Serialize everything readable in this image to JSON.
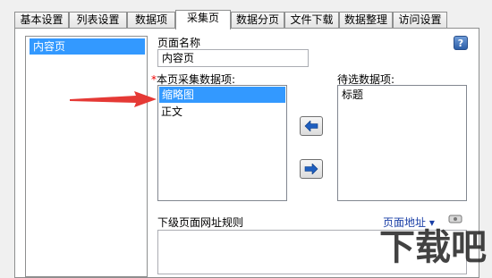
{
  "tabs": [
    {
      "label": "基本设置"
    },
    {
      "label": "列表设置"
    },
    {
      "label": "数据项"
    },
    {
      "label": "采集页"
    },
    {
      "label": "数据分页"
    },
    {
      "label": "文件下载"
    },
    {
      "label": "数据整理"
    },
    {
      "label": "访问设置"
    }
  ],
  "pages_list": {
    "items": [
      "内容页"
    ]
  },
  "page_name": {
    "label": "页面名称",
    "value": "内容页"
  },
  "collected_items": {
    "required_mark": "*",
    "label": "本页采集数据项:",
    "items": [
      "缩略图",
      "正文"
    ]
  },
  "pending_items": {
    "label": "待选数据项:",
    "items": [
      "标题"
    ]
  },
  "url_rule": {
    "label": "下级页面网址规则",
    "dropdown_label": "页面地址"
  },
  "watermark": {
    "text": "下载吧"
  },
  "colors": {
    "selection": "#3399ff",
    "arrow": "#e53935",
    "link": "#1a3fa6"
  }
}
